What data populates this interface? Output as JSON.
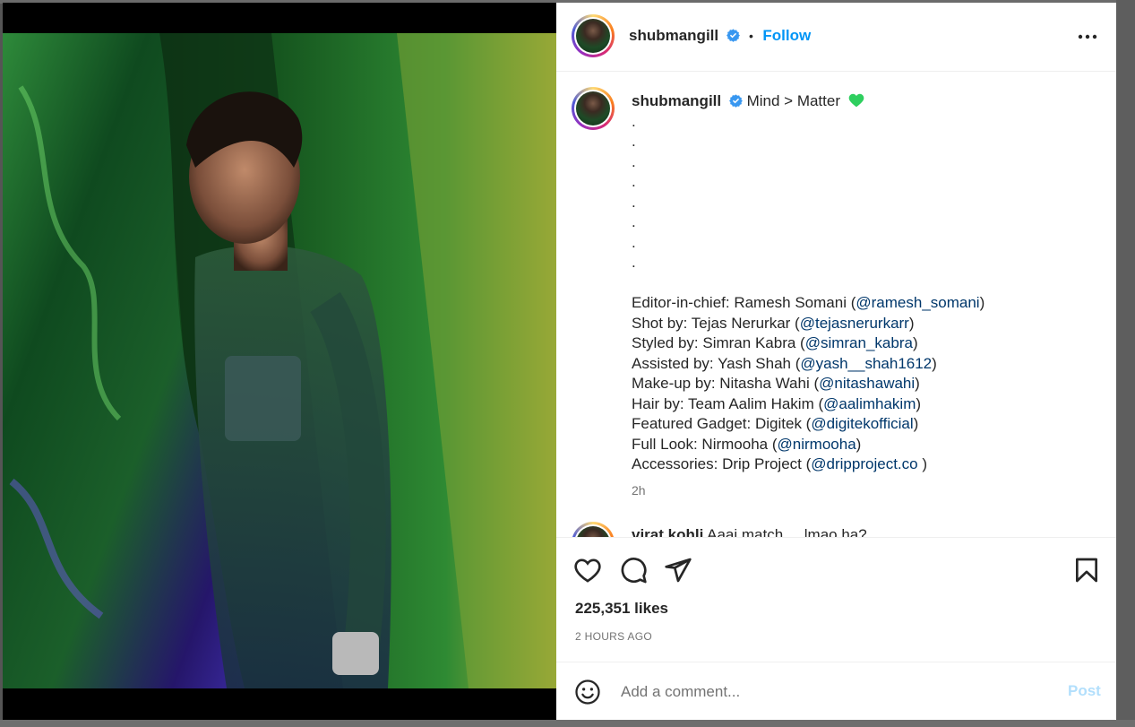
{
  "post": {
    "username": "shubmangill",
    "follow_label": "Follow",
    "separator": "•",
    "caption_text": "Mind > Matter",
    "caption_dots": [
      ".",
      ".",
      ".",
      ".",
      ".",
      ".",
      ".",
      "."
    ],
    "credits": [
      {
        "label": "Editor-in-chief: Ramesh Somani (",
        "handle": "@ramesh_somani",
        "end": ")"
      },
      {
        "label": "Shot by: Tejas Nerurkar (",
        "handle": "@tejasnerurkarr",
        "end": ")"
      },
      {
        "label": "Styled by: Simran Kabra (",
        "handle": "@simran_kabra",
        "end": ")"
      },
      {
        "label": "Assisted by: Yash Shah (",
        "handle": "@yash__shah1612",
        "end": ")"
      },
      {
        "label": "Make-up by: Nitasha Wahi (",
        "handle": "@nitashawahi",
        "end": ")"
      },
      {
        "label": "Hair by: Team Aalim Hakim (",
        "handle": "@aalimhakim",
        "end": ")"
      },
      {
        "label": "Featured Gadget: Digitek (",
        "handle": "@digitekofficial",
        "end": ")"
      },
      {
        "label": "Full Look: Nirmooha (",
        "handle": "@nirmooha",
        "end": ")"
      },
      {
        "label": "Accessories: Drip Project (",
        "handle": "@dripproject.co",
        "end": " )"
      }
    ],
    "caption_time": "2h",
    "next_comment_preview": "virat.kohli",
    "next_comment_text": "Aaaj match ... lmao ha?",
    "likes": "225,351 likes",
    "posted_ago": "2 HOURS AGO",
    "comment_placeholder": "Add a comment...",
    "post_label": "Post"
  },
  "icons": {
    "verified": "verified-badge-icon",
    "heart_emoji": "green-heart-emoji",
    "like": "heart-icon",
    "comment": "comment-icon",
    "share": "paper-plane-icon",
    "save": "bookmark-icon",
    "more": "more-options-icon",
    "emoji": "emoji-icon"
  },
  "colors": {
    "accent": "#0095f6",
    "mention": "#00376b",
    "secondary_text": "#737373",
    "verified": "#3897f0",
    "heart_emoji": "#2fcf5f",
    "post_disabled": "#b2dffc"
  }
}
